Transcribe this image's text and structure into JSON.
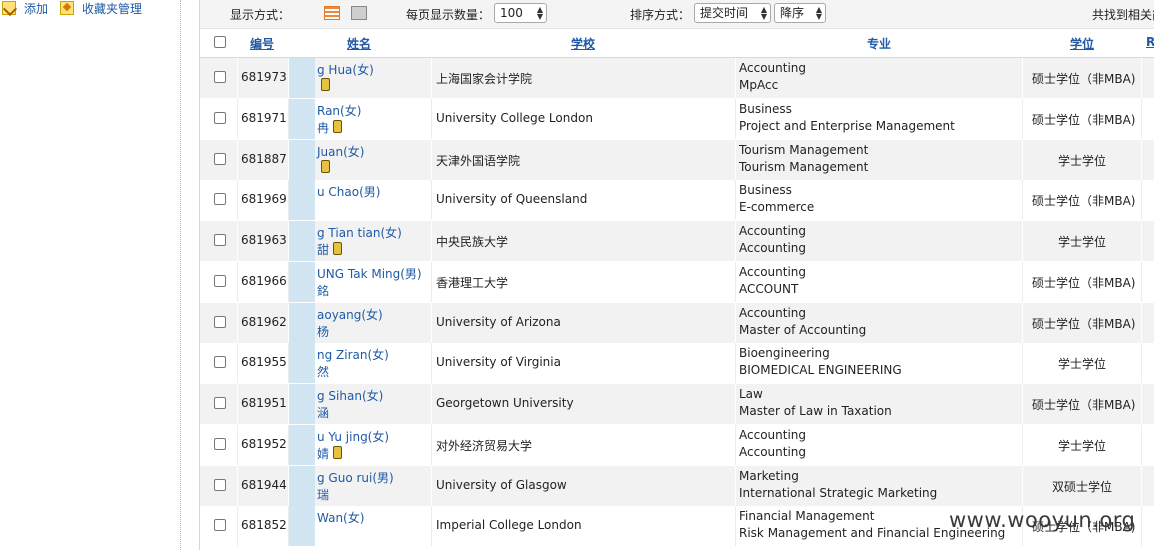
{
  "sidebar": {
    "add_label": "添加",
    "fav_label": "收藏夹管理"
  },
  "toolbar": {
    "display_label": "显示方式：",
    "per_page_label": "每页显示数量：",
    "per_page_value": "100",
    "sort_label": "排序方式：",
    "sort_field": "提交时间",
    "sort_order": "降序",
    "found_label": "共找到相关简"
  },
  "columns": {
    "id": "编号",
    "name": "姓名",
    "school": "学校",
    "major": "专业",
    "degree": "学位",
    "extra": "R"
  },
  "rows": [
    {
      "id": "681973",
      "name_en": "g Hua(女)",
      "name_zh": "",
      "attach": true,
      "school": "上海国家会计学院",
      "major1": "Accounting",
      "major2": "MpAcc",
      "degree": "硕士学位（非MBA)"
    },
    {
      "id": "681971",
      "name_en": "Ran(女)",
      "name_zh": "冉",
      "attach": true,
      "school": "University College London",
      "major1": "Business",
      "major2": "Project and Enterprise Management",
      "degree": "硕士学位（非MBA)"
    },
    {
      "id": "681887",
      "name_en": "Juan(女)",
      "name_zh": "",
      "attach": true,
      "school": "天津外国语学院",
      "major1": "Tourism Management",
      "major2": "Tourism Management",
      "degree": "学士学位"
    },
    {
      "id": "681969",
      "name_en": "u Chao(男)",
      "name_zh": "",
      "attach": false,
      "school": "University of Queensland",
      "major1": "Business",
      "major2": "E-commerce",
      "degree": "硕士学位（非MBA)"
    },
    {
      "id": "681963",
      "name_en": "g Tian tian(女)",
      "name_zh": "甜",
      "attach": true,
      "school": "中央民族大学",
      "major1": "Accounting",
      "major2": "Accounting",
      "degree": "学士学位"
    },
    {
      "id": "681966",
      "name_en": "UNG Tak Ming(男)",
      "name_zh": "銘",
      "attach": false,
      "school": "香港理工大学",
      "major1": "Accounting",
      "major2": "ACCOUNT",
      "degree": "硕士学位（非MBA)"
    },
    {
      "id": "681962",
      "name_en": "aoyang(女)",
      "name_zh": "杨",
      "attach": false,
      "school": "University of Arizona",
      "major1": "Accounting",
      "major2": "Master of Accounting",
      "degree": "硕士学位（非MBA)"
    },
    {
      "id": "681955",
      "name_en": "ng Ziran(女)",
      "name_zh": "然",
      "attach": false,
      "school": "University of Virginia",
      "major1": "Bioengineering",
      "major2": "BIOMEDICAL ENGINEERING",
      "degree": "学士学位"
    },
    {
      "id": "681951",
      "name_en": "g Sihan(女)",
      "name_zh": "涵",
      "attach": false,
      "school": "Georgetown University",
      "major1": "Law",
      "major2": "Master of Law in Taxation",
      "degree": "硕士学位（非MBA)"
    },
    {
      "id": "681952",
      "name_en": "u Yu jing(女)",
      "name_zh": "婧",
      "attach": true,
      "school": "对外经济贸易大学",
      "major1": "Accounting",
      "major2": "Accounting",
      "degree": "学士学位"
    },
    {
      "id": "681944",
      "name_en": "g Guo rui(男)",
      "name_zh": "瑞",
      "attach": false,
      "school": "University of Glasgow",
      "major1": "Marketing",
      "major2": "International Strategic Marketing",
      "degree": "双硕士学位"
    },
    {
      "id": "681852",
      "name_en": "Wan(女)",
      "name_zh": "",
      "attach": false,
      "school": "Imperial College London",
      "major1": "Financial Management",
      "major2": "Risk Management and Financial Engineering",
      "degree": "硕士学位（非MBA)"
    }
  ],
  "watermark": "www.wooyun.org"
}
